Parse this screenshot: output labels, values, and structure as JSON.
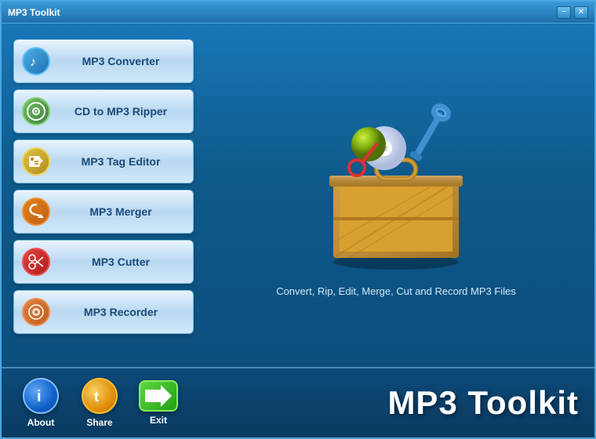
{
  "window": {
    "title": "MP3 Toolkit",
    "min_btn": "−",
    "close_btn": "✕"
  },
  "tools": [
    {
      "id": "converter",
      "label": "MP3 Converter",
      "icon_type": "converter",
      "icon_symbol": "♪"
    },
    {
      "id": "cd-ripper",
      "label": "CD to MP3 Ripper",
      "icon_type": "cd",
      "icon_symbol": "◎"
    },
    {
      "id": "tag-editor",
      "label": "MP3 Tag Editor",
      "icon_type": "tag",
      "icon_symbol": "🏷"
    },
    {
      "id": "merger",
      "label": "MP3 Merger",
      "icon_type": "merger",
      "icon_symbol": "⟳"
    },
    {
      "id": "cutter",
      "label": "MP3 Cutter",
      "icon_type": "cutter",
      "icon_symbol": "✂"
    },
    {
      "id": "recorder",
      "label": "MP3 Recorder",
      "icon_type": "recorder",
      "icon_symbol": "⏺"
    }
  ],
  "subtitle": "Convert, Rip, Edit, Merge, Cut and Record MP3 Files",
  "bottom": {
    "about_label": "About",
    "share_label": "Share",
    "exit_label": "Exit",
    "app_title": "MP3 Toolkit"
  }
}
